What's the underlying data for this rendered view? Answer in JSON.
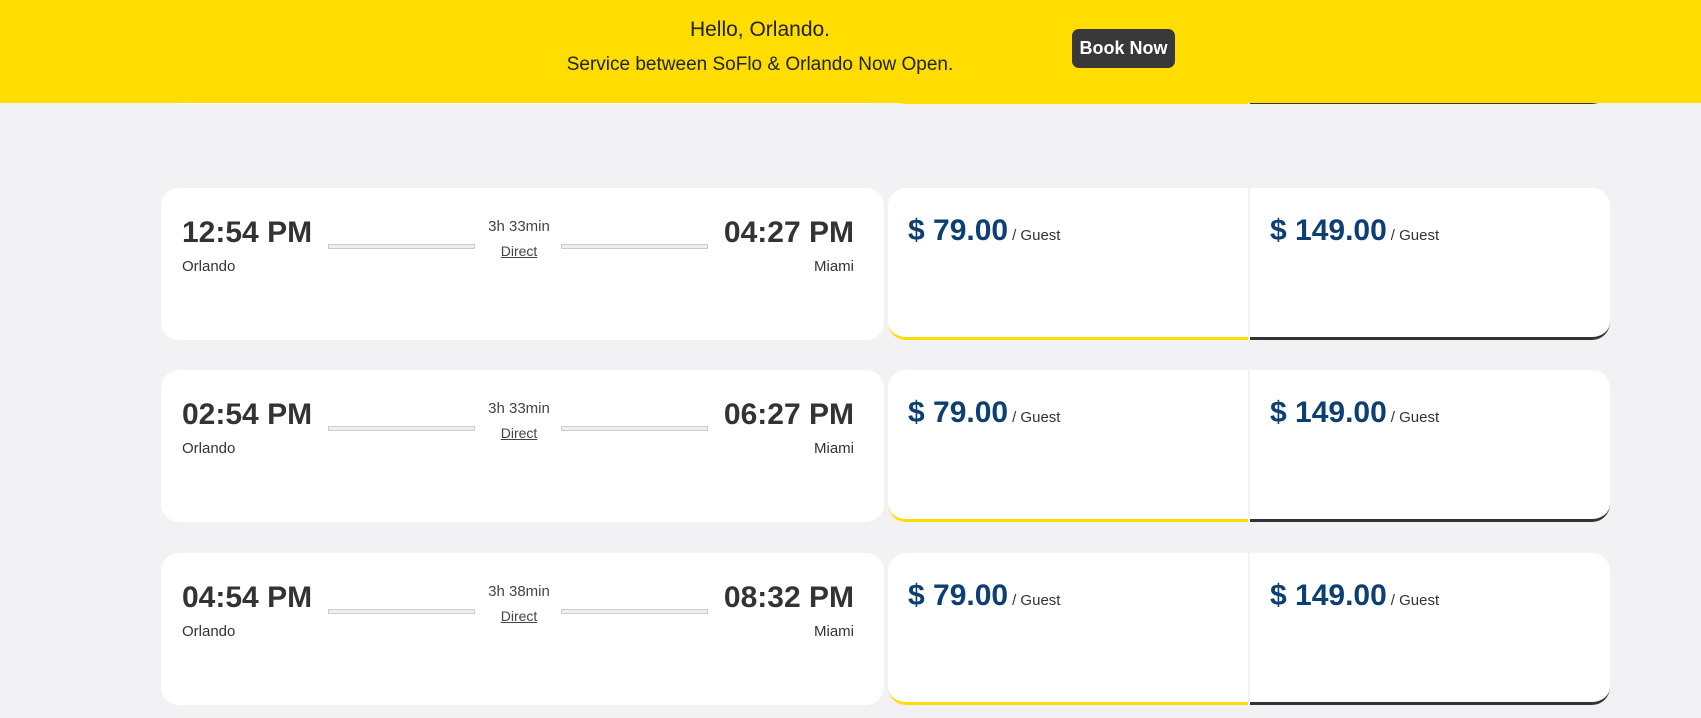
{
  "banner": {
    "line1": "Hello, Orlando.",
    "line2": "Service between SoFlo & Orlando Now Open.",
    "button": "Book Now",
    "color": "#FFDD00"
  },
  "colors": {
    "price": "#0d3f73",
    "fare1_accent": "#FFDD00",
    "fare2_accent": "#333333"
  },
  "trips": [
    {
      "depart": "12:54 PM",
      "origin": "Orlando",
      "duration": "3h 33min",
      "stops": "Direct",
      "arrive": "04:27 PM",
      "destination": "Miami",
      "fare1": "$ 79.00",
      "fare2": "$ 149.00",
      "unit": "/ Guest"
    },
    {
      "depart": "02:54 PM",
      "origin": "Orlando",
      "duration": "3h 33min",
      "stops": "Direct",
      "arrive": "06:27 PM",
      "destination": "Miami",
      "fare1": "$ 79.00",
      "fare2": "$ 149.00",
      "unit": "/ Guest"
    },
    {
      "depart": "04:54 PM",
      "origin": "Orlando",
      "duration": "3h 38min",
      "stops": "Direct",
      "arrive": "08:32 PM",
      "destination": "Miami",
      "fare1": "$ 79.00",
      "fare2": "$ 149.00",
      "unit": "/ Guest"
    }
  ]
}
